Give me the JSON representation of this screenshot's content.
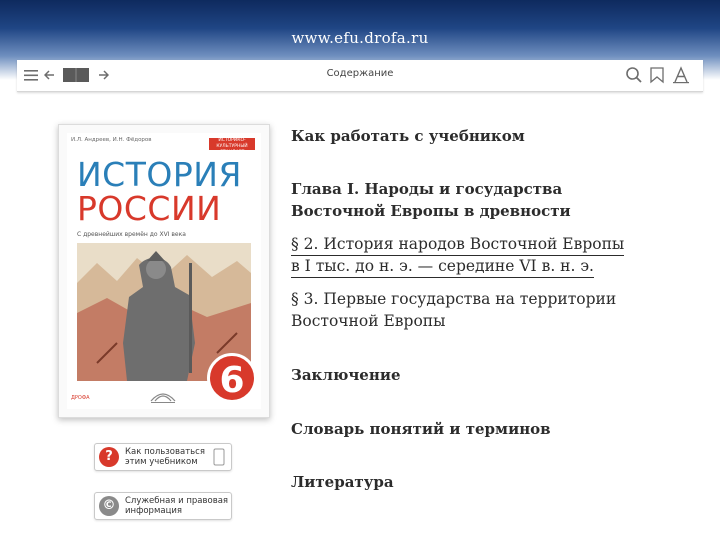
{
  "banner": {
    "url": "www.efu.drofa.ru"
  },
  "toolbar": {
    "title": "Содержание",
    "icons": [
      "menu-icon",
      "back-icon",
      "book-icon",
      "forward-icon",
      "search-icon",
      "bookmark-icon",
      "font-size-icon"
    ]
  },
  "cover": {
    "authors": "И.Л. Андреев, И.Н. Фёдоров",
    "badge": "ИСТОРИКО-КУЛЬТУРНЫЙ СТАНДАРТ",
    "title_line1": "ИСТОРИЯ",
    "title_line2": "РОССИИ",
    "subtitle": "С древнейших времён до XVI века",
    "grade": "6",
    "publisher": "ДРОФА"
  },
  "side_buttons": [
    {
      "label_line1": "Как пользоваться",
      "label_line2": "этим учебником",
      "icon": "?",
      "color": "#d8392b"
    },
    {
      "label_line1": "Служебная и правовая",
      "label_line2": "информация",
      "icon": "©",
      "color": "#8a8a8a"
    }
  ],
  "toc": {
    "how_to": "Как работать с учебником",
    "chapter1_line1": "Глава I. Народы и государства",
    "chapter1_line2": "Восточной Европы в древности",
    "section2_line1": "§ 2. История народов Восточной Европы",
    "section2_line2": "в I тыс. до н. э. — середине VI в. н. э.",
    "section3_line1": "§ 3. Первые государства на территории",
    "section3_line2": "Восточной Европы",
    "conclusion": "Заключение",
    "glossary": "Словарь понятий и терминов",
    "literature": "Литература"
  }
}
